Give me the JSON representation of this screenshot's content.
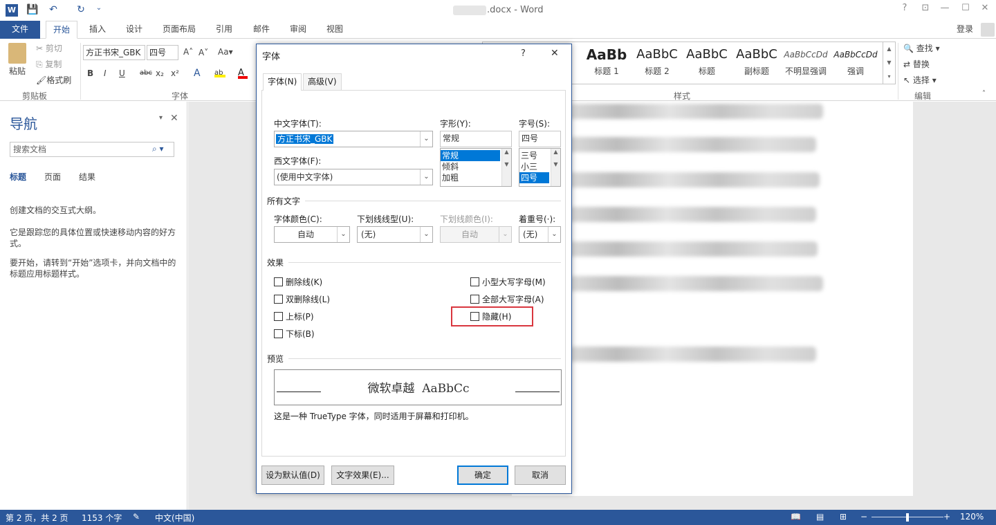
{
  "window": {
    "title": ".docx - Word",
    "help": "?",
    "signin": "登录"
  },
  "quick_access": {
    "word_icon": "W",
    "save": "💾",
    "undo": "↶",
    "redo": "↻",
    "more": "⌄"
  },
  "tabs": [
    "文件",
    "开始",
    "插入",
    "设计",
    "页面布局",
    "引用",
    "邮件",
    "审阅",
    "视图"
  ],
  "ribbon": {
    "clipboard": {
      "paste": "粘贴",
      "cut": "剪切",
      "copy": "复制",
      "format_painter": "格式刷",
      "label": "剪贴板"
    },
    "font": {
      "face": "方正书宋_GBK",
      "size": "四号",
      "label": "字体",
      "bold": "B",
      "italic": "I",
      "underline": "U",
      "strike": "abc",
      "sub": "x₂",
      "sup": "x²"
    },
    "styles": {
      "label": "样式",
      "items": [
        {
          "preview": "AaBb",
          "name": "标题 1"
        },
        {
          "preview": "AaBbC",
          "name": "标题 2"
        },
        {
          "preview": "AaBbC",
          "name": "标题"
        },
        {
          "preview": "AaBbC",
          "name": "副标题"
        },
        {
          "preview": "AaBbCcDd",
          "name": "不明显强调"
        },
        {
          "preview": "AaBbCcDd",
          "name": "强调"
        }
      ]
    },
    "editing": {
      "find": "查找",
      "replace": "替换",
      "select": "选择",
      "label": "编辑"
    }
  },
  "nav": {
    "title": "导航",
    "search_placeholder": "搜索文档",
    "tabs": [
      "标题",
      "页面",
      "结果"
    ],
    "p1": "创建文档的交互式大纲。",
    "p2": "它是跟踪您的具体位置或快速移动内容的好方式。",
    "p3": "要开始，请转到“开始”选项卡，并向文档中的标题应用标题样式。"
  },
  "dialog": {
    "title": "字体",
    "help": "?",
    "close": "✕",
    "tabs": [
      "字体(N)",
      "高级(V)"
    ],
    "cn_font_label": "中文字体(T):",
    "cn_font_value": "方正书宋_GBK",
    "style_label": "字形(Y):",
    "style_value": "常规",
    "style_list": [
      "常规",
      "倾斜",
      "加粗"
    ],
    "size_label": "字号(S):",
    "size_value": "四号",
    "size_list": [
      "三号",
      "小三",
      "四号"
    ],
    "west_font_label": "西文字体(F):",
    "west_font_value": "(使用中文字体)",
    "all_text_label": "所有文字",
    "color_label": "字体颜色(C):",
    "color_value": "自动",
    "underline_label": "下划线线型(U):",
    "underline_value": "(无)",
    "underline_color_label": "下划线颜色(I):",
    "underline_color_value": "自动",
    "emphasis_label": "着重号(·):",
    "emphasis_value": "(无)",
    "effects_label": "效果",
    "effects_left": [
      "删除线(K)",
      "双删除线(L)",
      "上标(P)",
      "下标(B)"
    ],
    "effects_right": [
      "小型大写字母(M)",
      "全部大写字母(A)",
      "隐藏(H)"
    ],
    "preview_label": "预览",
    "preview_text": "微软卓越  AaBbCc",
    "preview_note": "这是一种 TrueType 字体，同时适用于屏幕和打印机。",
    "btn_default": "设为默认值(D)",
    "btn_effects": "文字效果(E)...",
    "btn_ok": "确定",
    "btn_cancel": "取消",
    "highlight_color": "#d9363e"
  },
  "status": {
    "page": "第 2 页，共 2 页",
    "words": "1153 个字",
    "lang": "中文(中国)",
    "zoom": "120%"
  },
  "colors": {
    "accent": "#2b579a"
  }
}
